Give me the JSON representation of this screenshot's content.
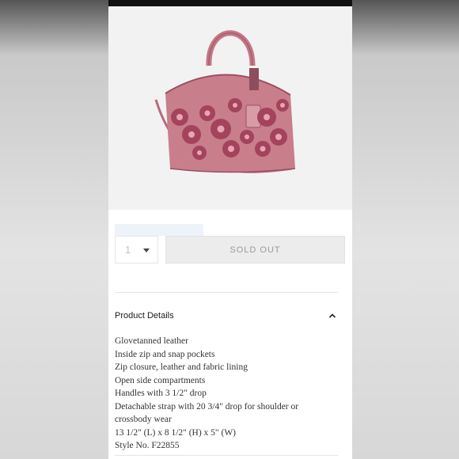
{
  "quantity": {
    "value": "1",
    "arrow_icon": "chevron-down-icon"
  },
  "buy_button": {
    "label": "SOLD OUT",
    "state": "disabled"
  },
  "product_details": {
    "title": "Product Details",
    "toggle_icon": "chevron-up-icon",
    "items": [
      "Glovetanned leather",
      "Inside zip and snap pockets",
      "Zip closure, leather and fabric lining",
      "Open side compartments",
      "Handles with 3 1/2\" drop",
      "Detachable strap with 20 3/4\" drop for shoulder or crossbody wear",
      "13 1/2\" (L) x 8 1/2\" (H) x 5\" (W)",
      "Style No. F22855"
    ]
  },
  "colors": {
    "bag": "#c97e8c",
    "bag_dark": "#9a4f62",
    "flower": "#a3445c",
    "image_bg": "#f2f2f2",
    "swatch_strip": "#eef3fa"
  }
}
